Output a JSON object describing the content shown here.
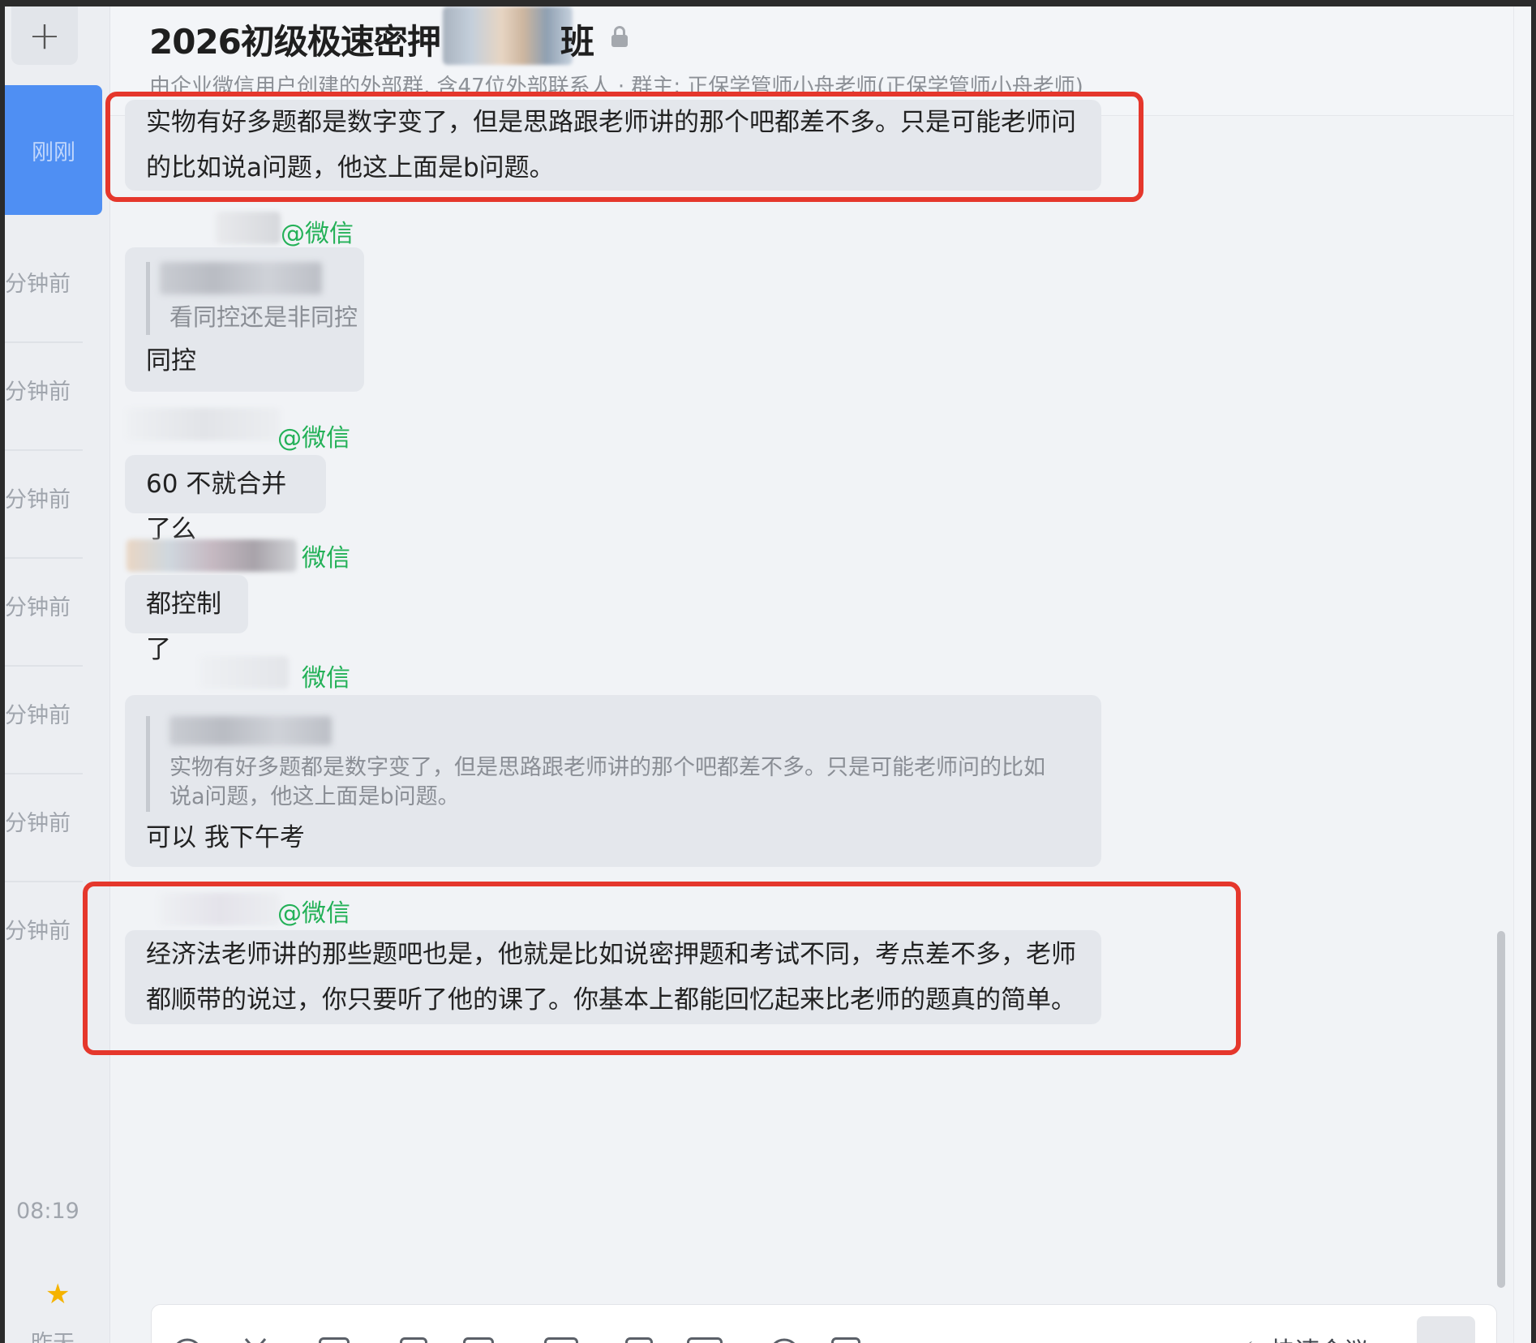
{
  "sidebar": {
    "add_label": "+",
    "active_label": "刚刚",
    "times": [
      "分钟前",
      "分钟前",
      "分钟前",
      "分钟前",
      "分钟前",
      "分钟前",
      "分钟前"
    ],
    "last_time": "08:19",
    "star": "★",
    "yesterday": "昨天"
  },
  "header": {
    "title": "2026初级极速密押",
    "title_suffix": "班",
    "subtitle": "由企业微信用户创建的外部群, 含47位外部联系人 · 群主: 正保学管师小舟老师(正保学管师小舟老师)"
  },
  "messages": [
    {
      "text": "实物有好多题都是数字变了，但是思路跟老师讲的那个吧都差不多。只是可能老师问的比如说a问题，他这上面是b问题。"
    },
    {
      "sender_tag": "@微信",
      "quote": "看同控还是非同控",
      "text": "同控"
    },
    {
      "sender_tag": "@微信",
      "text": "60 不就合并了么"
    },
    {
      "sender_tag": "微信",
      "text": "都控制了"
    },
    {
      "sender_tag": "微信",
      "quote": "实物有好多题都是数字变了，但是思路跟老师讲的那个吧都差不多。只是可能老师问的比如说a问题，他这上面是b问题。",
      "text": "可以 我下午考"
    },
    {
      "sender_tag": "@微信",
      "text": "经济法老师讲的那些题吧也是，他就是比如说密押题和考试不同，考点差不多，老师都顺带的说过，你只要听了他的课了。你基本上都能回忆起来比老师的题真的简单。"
    }
  ],
  "toolbar": {
    "icons": [
      "emoji-icon",
      "scissors-icon",
      "image-icon",
      "doc-icon",
      "calendar-icon",
      "folder-icon",
      "doc-x-icon",
      "keyboard-icon",
      "chat-icon",
      "plus-box-icon"
    ],
    "quick_meeting": "快速会议"
  },
  "colors": {
    "accent": "#4f8ff3",
    "highlight": "#e5372c",
    "sender": "#24b158"
  }
}
